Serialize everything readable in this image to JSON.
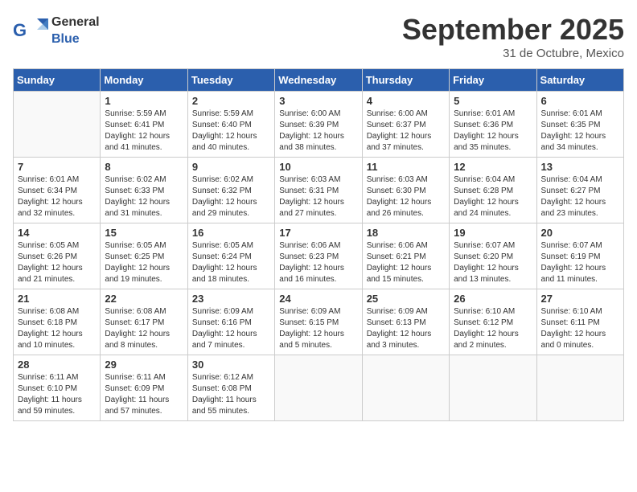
{
  "logo": {
    "text_general": "General",
    "text_blue": "Blue"
  },
  "header": {
    "month_year": "September 2025",
    "subtitle": "31 de Octubre, Mexico"
  },
  "weekdays": [
    "Sunday",
    "Monday",
    "Tuesday",
    "Wednesday",
    "Thursday",
    "Friday",
    "Saturday"
  ],
  "weeks": [
    [
      {
        "day": "",
        "info": ""
      },
      {
        "day": "1",
        "info": "Sunrise: 5:59 AM\nSunset: 6:41 PM\nDaylight: 12 hours\nand 41 minutes."
      },
      {
        "day": "2",
        "info": "Sunrise: 5:59 AM\nSunset: 6:40 PM\nDaylight: 12 hours\nand 40 minutes."
      },
      {
        "day": "3",
        "info": "Sunrise: 6:00 AM\nSunset: 6:39 PM\nDaylight: 12 hours\nand 38 minutes."
      },
      {
        "day": "4",
        "info": "Sunrise: 6:00 AM\nSunset: 6:37 PM\nDaylight: 12 hours\nand 37 minutes."
      },
      {
        "day": "5",
        "info": "Sunrise: 6:01 AM\nSunset: 6:36 PM\nDaylight: 12 hours\nand 35 minutes."
      },
      {
        "day": "6",
        "info": "Sunrise: 6:01 AM\nSunset: 6:35 PM\nDaylight: 12 hours\nand 34 minutes."
      }
    ],
    [
      {
        "day": "7",
        "info": "Sunrise: 6:01 AM\nSunset: 6:34 PM\nDaylight: 12 hours\nand 32 minutes."
      },
      {
        "day": "8",
        "info": "Sunrise: 6:02 AM\nSunset: 6:33 PM\nDaylight: 12 hours\nand 31 minutes."
      },
      {
        "day": "9",
        "info": "Sunrise: 6:02 AM\nSunset: 6:32 PM\nDaylight: 12 hours\nand 29 minutes."
      },
      {
        "day": "10",
        "info": "Sunrise: 6:03 AM\nSunset: 6:31 PM\nDaylight: 12 hours\nand 27 minutes."
      },
      {
        "day": "11",
        "info": "Sunrise: 6:03 AM\nSunset: 6:30 PM\nDaylight: 12 hours\nand 26 minutes."
      },
      {
        "day": "12",
        "info": "Sunrise: 6:04 AM\nSunset: 6:28 PM\nDaylight: 12 hours\nand 24 minutes."
      },
      {
        "day": "13",
        "info": "Sunrise: 6:04 AM\nSunset: 6:27 PM\nDaylight: 12 hours\nand 23 minutes."
      }
    ],
    [
      {
        "day": "14",
        "info": "Sunrise: 6:05 AM\nSunset: 6:26 PM\nDaylight: 12 hours\nand 21 minutes."
      },
      {
        "day": "15",
        "info": "Sunrise: 6:05 AM\nSunset: 6:25 PM\nDaylight: 12 hours\nand 19 minutes."
      },
      {
        "day": "16",
        "info": "Sunrise: 6:05 AM\nSunset: 6:24 PM\nDaylight: 12 hours\nand 18 minutes."
      },
      {
        "day": "17",
        "info": "Sunrise: 6:06 AM\nSunset: 6:23 PM\nDaylight: 12 hours\nand 16 minutes."
      },
      {
        "day": "18",
        "info": "Sunrise: 6:06 AM\nSunset: 6:21 PM\nDaylight: 12 hours\nand 15 minutes."
      },
      {
        "day": "19",
        "info": "Sunrise: 6:07 AM\nSunset: 6:20 PM\nDaylight: 12 hours\nand 13 minutes."
      },
      {
        "day": "20",
        "info": "Sunrise: 6:07 AM\nSunset: 6:19 PM\nDaylight: 12 hours\nand 11 minutes."
      }
    ],
    [
      {
        "day": "21",
        "info": "Sunrise: 6:08 AM\nSunset: 6:18 PM\nDaylight: 12 hours\nand 10 minutes."
      },
      {
        "day": "22",
        "info": "Sunrise: 6:08 AM\nSunset: 6:17 PM\nDaylight: 12 hours\nand 8 minutes."
      },
      {
        "day": "23",
        "info": "Sunrise: 6:09 AM\nSunset: 6:16 PM\nDaylight: 12 hours\nand 7 minutes."
      },
      {
        "day": "24",
        "info": "Sunrise: 6:09 AM\nSunset: 6:15 PM\nDaylight: 12 hours\nand 5 minutes."
      },
      {
        "day": "25",
        "info": "Sunrise: 6:09 AM\nSunset: 6:13 PM\nDaylight: 12 hours\nand 3 minutes."
      },
      {
        "day": "26",
        "info": "Sunrise: 6:10 AM\nSunset: 6:12 PM\nDaylight: 12 hours\nand 2 minutes."
      },
      {
        "day": "27",
        "info": "Sunrise: 6:10 AM\nSunset: 6:11 PM\nDaylight: 12 hours\nand 0 minutes."
      }
    ],
    [
      {
        "day": "28",
        "info": "Sunrise: 6:11 AM\nSunset: 6:10 PM\nDaylight: 11 hours\nand 59 minutes."
      },
      {
        "day": "29",
        "info": "Sunrise: 6:11 AM\nSunset: 6:09 PM\nDaylight: 11 hours\nand 57 minutes."
      },
      {
        "day": "30",
        "info": "Sunrise: 6:12 AM\nSunset: 6:08 PM\nDaylight: 11 hours\nand 55 minutes."
      },
      {
        "day": "",
        "info": ""
      },
      {
        "day": "",
        "info": ""
      },
      {
        "day": "",
        "info": ""
      },
      {
        "day": "",
        "info": ""
      }
    ]
  ]
}
